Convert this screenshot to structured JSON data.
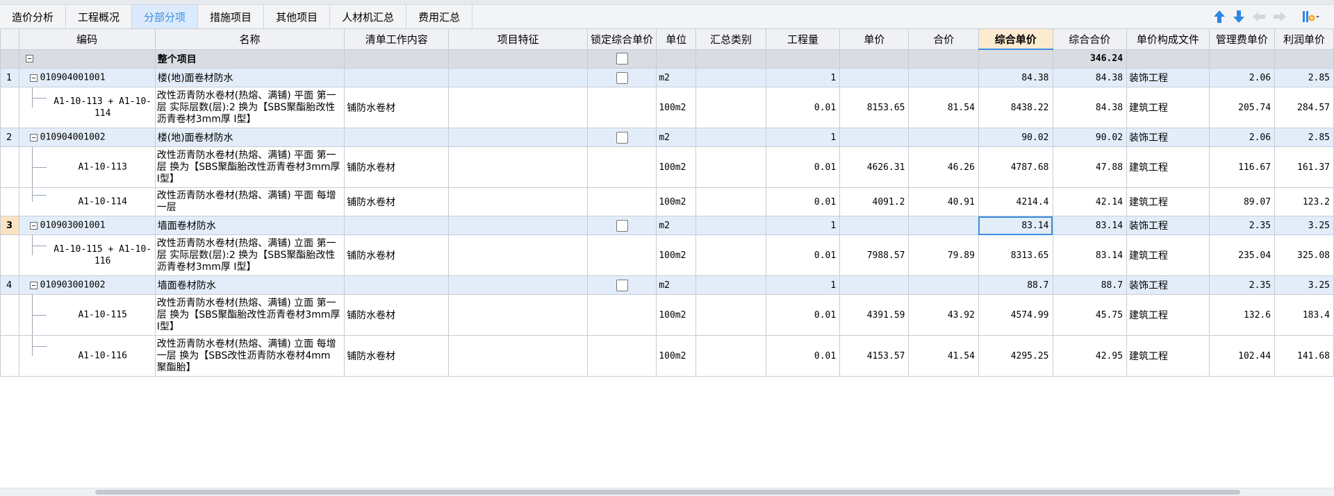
{
  "tabs": [
    {
      "label": "造价分析",
      "active": false
    },
    {
      "label": "工程概况",
      "active": false
    },
    {
      "label": "分部分项",
      "active": true
    },
    {
      "label": "措施项目",
      "active": false
    },
    {
      "label": "其他项目",
      "active": false
    },
    {
      "label": "人材机汇总",
      "active": false
    },
    {
      "label": "费用汇总",
      "active": false
    }
  ],
  "toolbar_icons": [
    "move-up-icon",
    "move-down-icon",
    "demote-icon",
    "promote-icon",
    "column-settings-icon"
  ],
  "colors": {
    "accent": "#3b8de0",
    "tab_active_bg": "#dbeafc",
    "group_row_bg": "#e3edfa",
    "total_row_bg": "#d9dde3",
    "header_bg": "#eff1f5",
    "highlight_header_bg": "#fdebd0"
  },
  "columns": [
    "",
    "编码",
    "名称",
    "清单工作内容",
    "项目特征",
    "锁定综合单价",
    "单位",
    "汇总类别",
    "工程量",
    "单价",
    "合价",
    "综合单价",
    "综合合价",
    "单价构成文件",
    "管理费单价",
    "利润单价"
  ],
  "highlighted_column": "综合单价",
  "total_row": {
    "code": "",
    "name": "整个项目",
    "total": "346.24"
  },
  "rows": [
    {
      "type": "group",
      "num": "1",
      "code": "010904001001",
      "name": "楼(地)面卷材防水",
      "content": "",
      "feature": "",
      "unit": "m2",
      "category": "",
      "qty": "1",
      "price": "",
      "amount": "",
      "unit_price": "84.38",
      "total": "84.38",
      "file": "装饰工程",
      "mgmt": "2.06",
      "profit": "2.85",
      "selected": false
    },
    {
      "type": "sub",
      "lines": 2,
      "last": true,
      "code": "A1-10-113 + A1-10-114",
      "name": "改性沥青防水卷材(热熔、满铺) 平面 第一层  实际层数(层):2  换为【SBS聚酯胎改性沥青卷材3mm厚 I型】",
      "content": "铺防水卷材",
      "feature": "",
      "unit": "100m2",
      "category": "",
      "qty": "0.01",
      "price": "8153.65",
      "amount": "81.54",
      "unit_price": "8438.22",
      "total": "84.38",
      "file": "建筑工程",
      "mgmt": "205.74",
      "profit": "284.57"
    },
    {
      "type": "group",
      "num": "2",
      "code": "010904001002",
      "name": "楼(地)面卷材防水",
      "content": "",
      "feature": "",
      "unit": "m2",
      "category": "",
      "qty": "1",
      "price": "",
      "amount": "",
      "unit_price": "90.02",
      "total": "90.02",
      "file": "装饰工程",
      "mgmt": "2.06",
      "profit": "2.85",
      "selected": false
    },
    {
      "type": "sub",
      "lines": 2,
      "last": false,
      "code": "A1-10-113",
      "name": "改性沥青防水卷材(热熔、满铺) 平面 第一层  换为【SBS聚酯胎改性沥青卷材3mm厚 I型】",
      "content": "铺防水卷材",
      "feature": "",
      "unit": "100m2",
      "category": "",
      "qty": "0.01",
      "price": "4626.31",
      "amount": "46.26",
      "unit_price": "4787.68",
      "total": "47.88",
      "file": "建筑工程",
      "mgmt": "116.67",
      "profit": "161.37"
    },
    {
      "type": "sub",
      "lines": 1,
      "last": true,
      "code": "A1-10-114",
      "name": "改性沥青防水卷材(热熔、满铺) 平面 每增一层",
      "content": "铺防水卷材",
      "feature": "",
      "unit": "100m2",
      "category": "",
      "qty": "0.01",
      "price": "4091.2",
      "amount": "40.91",
      "unit_price": "4214.4",
      "total": "42.14",
      "file": "建筑工程",
      "mgmt": "89.07",
      "profit": "123.2"
    },
    {
      "type": "group",
      "num": "3",
      "code": "010903001001",
      "name": "墙面卷材防水",
      "content": "",
      "feature": "",
      "unit": "m2",
      "category": "",
      "qty": "1",
      "price": "",
      "amount": "",
      "unit_price": "83.14",
      "total": "83.14",
      "file": "装饰工程",
      "mgmt": "2.35",
      "profit": "3.25",
      "selected": true
    },
    {
      "type": "sub",
      "lines": 2,
      "last": true,
      "code": "A1-10-115 + A1-10-116",
      "name": "改性沥青防水卷材(热熔、满铺) 立面 第一层  实际层数(层):2  换为【SBS聚酯胎改性沥青卷材3mm厚 I型】",
      "content": "铺防水卷材",
      "feature": "",
      "unit": "100m2",
      "category": "",
      "qty": "0.01",
      "price": "7988.57",
      "amount": "79.89",
      "unit_price": "8313.65",
      "total": "83.14",
      "file": "建筑工程",
      "mgmt": "235.04",
      "profit": "325.08"
    },
    {
      "type": "group",
      "num": "4",
      "code": "010903001002",
      "name": "墙面卷材防水",
      "content": "",
      "feature": "",
      "unit": "m2",
      "category": "",
      "qty": "1",
      "price": "",
      "amount": "",
      "unit_price": "88.7",
      "total": "88.7",
      "file": "装饰工程",
      "mgmt": "2.35",
      "profit": "3.25",
      "selected": false
    },
    {
      "type": "sub",
      "lines": 2,
      "last": false,
      "code": "A1-10-115",
      "name": "改性沥青防水卷材(热熔、满铺) 立面 第一层  换为【SBS聚酯胎改性沥青卷材3mm厚 I型】",
      "content": "铺防水卷材",
      "feature": "",
      "unit": "100m2",
      "category": "",
      "qty": "0.01",
      "price": "4391.59",
      "amount": "43.92",
      "unit_price": "4574.99",
      "total": "45.75",
      "file": "建筑工程",
      "mgmt": "132.6",
      "profit": "183.4"
    },
    {
      "type": "sub",
      "lines": 2,
      "last": true,
      "code": "A1-10-116",
      "name": "改性沥青防水卷材(热熔、满铺) 立面 每增一层  换为【SBS改性沥青防水卷材4mm 聚酯胎】",
      "content": "铺防水卷材",
      "feature": "",
      "unit": "100m2",
      "category": "",
      "qty": "0.01",
      "price": "4153.57",
      "amount": "41.54",
      "unit_price": "4295.25",
      "total": "42.95",
      "file": "建筑工程",
      "mgmt": "102.44",
      "profit": "141.68"
    }
  ]
}
